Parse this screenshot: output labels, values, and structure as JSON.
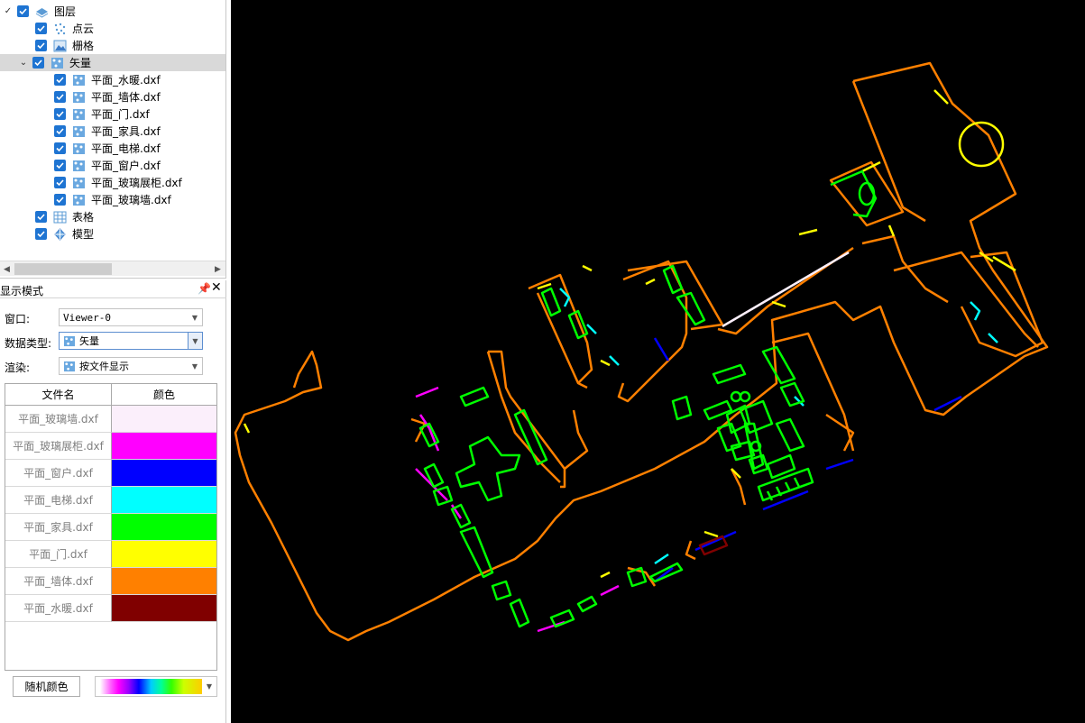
{
  "layer_tree": {
    "root": {
      "label": "图层"
    },
    "point_cloud": {
      "label": "点云"
    },
    "raster": {
      "label": "栅格"
    },
    "vector": {
      "label": "矢量",
      "children": [
        "平面_水暖.dxf",
        "平面_墙体.dxf",
        "平面_门.dxf",
        "平面_家具.dxf",
        "平面_电梯.dxf",
        "平面_窗户.dxf",
        "平面_玻璃展柜.dxf",
        "平面_玻璃墙.dxf"
      ]
    },
    "table": {
      "label": "表格"
    },
    "model": {
      "label": "模型"
    }
  },
  "display_panel": {
    "title": "显示模式",
    "window_label": "窗口:",
    "window_value": "Viewer-0",
    "datatype_label": "数据类型:",
    "datatype_value": "矢量",
    "render_label": "渲染:",
    "render_value": "按文件显示",
    "table_headers": {
      "filename": "文件名",
      "color": "颜色"
    },
    "rows": [
      {
        "name": "平面_玻璃墙.dxf",
        "color": "#fbeffb"
      },
      {
        "name": "平面_玻璃展柜.dxf",
        "color": "#ff00ff"
      },
      {
        "name": "平面_窗户.dxf",
        "color": "#0000ff"
      },
      {
        "name": "平面_电梯.dxf",
        "color": "#00ffff"
      },
      {
        "name": "平面_家具.dxf",
        "color": "#00ff00"
      },
      {
        "name": "平面_门.dxf",
        "color": "#ffff00"
      },
      {
        "name": "平面_墙体.dxf",
        "color": "#ff8000"
      },
      {
        "name": "平面_水暖.dxf",
        "color": "#800000"
      }
    ],
    "random_color_button": "随机颜色"
  },
  "viewer": {
    "background": "#000000",
    "layer_colors": {
      "wall": "#ff8000",
      "furniture": "#00ff00",
      "door": "#ffff00",
      "elevator": "#00ffff",
      "window": "#0000ff",
      "glass_cabinet": "#ff00ff",
      "glass_wall": "#fbeffb",
      "plumbing": "#800000"
    }
  }
}
